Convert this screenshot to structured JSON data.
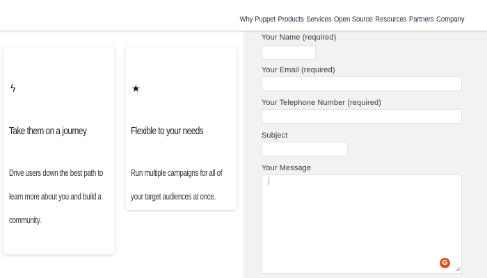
{
  "nav": {
    "items": [
      "Why Puppet",
      "Products",
      "Services",
      "Open Source",
      "Resources",
      "Partners",
      "Company"
    ]
  },
  "cards": [
    {
      "icon": "lightning-icon",
      "icon_glyph": "ϟ",
      "title": "Take them on a journey",
      "desc": "Drive users down the best path to learn more about you and build a community."
    },
    {
      "icon": "star-icon",
      "icon_glyph": "★",
      "title": "Flexible to your needs",
      "desc": "Run multiple campaigns for all of your target audiences at once."
    }
  ],
  "form": {
    "name_label": "Your Name (required)",
    "email_label": "Your Email (required)",
    "phone_label": "Your Telephone Number (required)",
    "subject_label": "Subject",
    "message_label": "Your Message",
    "name_value": "",
    "email_value": "",
    "phone_value": "",
    "subject_value": "",
    "message_value": "",
    "grammarly_glyph": "G"
  },
  "colors": {
    "form_bg": "#f2f2f2",
    "grammarly": "#d9531e"
  }
}
